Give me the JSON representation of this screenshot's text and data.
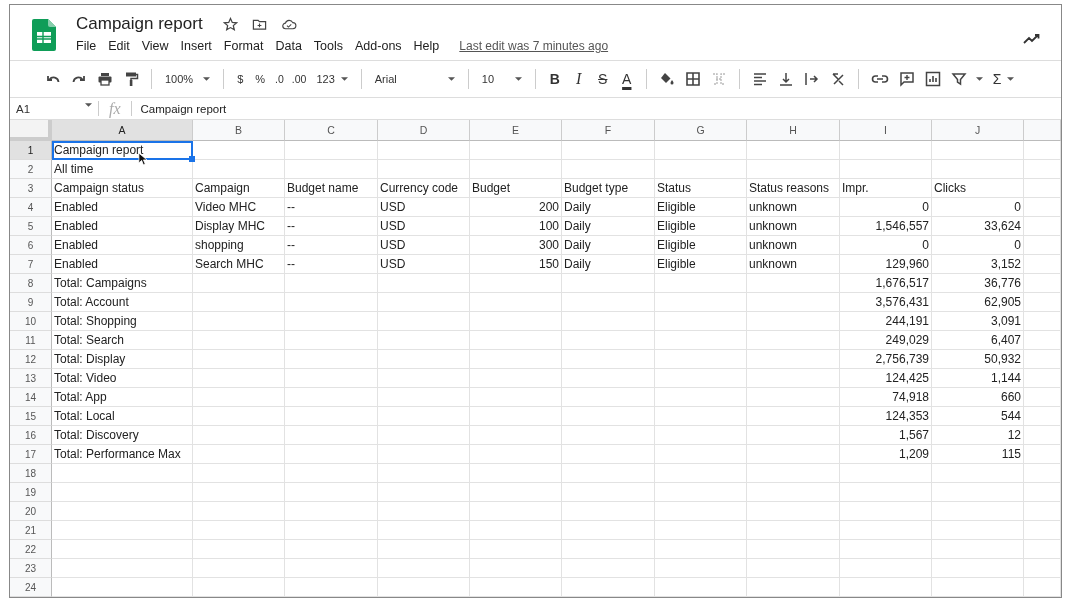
{
  "document": {
    "title": "Campaign report"
  },
  "menu": [
    "File",
    "Edit",
    "View",
    "Insert",
    "Format",
    "Data",
    "Tools",
    "Add-ons",
    "Help"
  ],
  "last_edit": "Last edit was 7 minutes ago",
  "toolbar": {
    "zoom": "100%",
    "currency": "$",
    "percent": "%",
    "decrease_decimals": ".0",
    "increase_decimals": ".00",
    "more_formats": "123",
    "font": "Arial",
    "font_size": "10",
    "bold": "B",
    "italic": "I",
    "strikethrough": "S",
    "text_color": "A",
    "functions": "Σ"
  },
  "formula_bar": {
    "cell_ref": "A1",
    "fx": "fx",
    "value": "Campaign report"
  },
  "columns": [
    {
      "letter": "A",
      "selected": true
    },
    {
      "letter": "B",
      "selected": false
    },
    {
      "letter": "C",
      "selected": false
    },
    {
      "letter": "D",
      "selected": false
    },
    {
      "letter": "E",
      "selected": false
    },
    {
      "letter": "F",
      "selected": false
    },
    {
      "letter": "G",
      "selected": false
    },
    {
      "letter": "H",
      "selected": false
    },
    {
      "letter": "I",
      "selected": false
    },
    {
      "letter": "J",
      "selected": false
    }
  ],
  "rows": [
    {
      "number": "1",
      "selected": true,
      "cells": {
        "A": "Campaign report"
      }
    },
    {
      "number": "2",
      "selected": false,
      "cells": {
        "A": "All time"
      }
    },
    {
      "number": "3",
      "selected": false,
      "cells": {
        "A": "Campaign status",
        "B": "Campaign",
        "C": "Budget name",
        "D": "Currency code",
        "E": "Budget",
        "F": "Budget type",
        "G": "Status",
        "H": "Status reasons",
        "I": "Impr.",
        "J": "Clicks"
      }
    },
    {
      "number": "4",
      "selected": false,
      "cells": {
        "A": "Enabled",
        "B": "Video MHC",
        "C": "--",
        "D": "USD",
        "E": "200",
        "F": "Daily",
        "G": "Eligible",
        "H": "unknown",
        "I": "0",
        "J": "0"
      }
    },
    {
      "number": "5",
      "selected": false,
      "cells": {
        "A": "Enabled",
        "B": "Display MHC",
        "C": "--",
        "D": "USD",
        "E": "100",
        "F": "Daily",
        "G": "Eligible",
        "H": "unknown",
        "I": "1,546,557",
        "J": "33,624"
      }
    },
    {
      "number": "6",
      "selected": false,
      "cells": {
        "A": "Enabled",
        "B": "shopping",
        "C": "--",
        "D": "USD",
        "E": "300",
        "F": "Daily",
        "G": "Eligible",
        "H": "unknown",
        "I": "0",
        "J": "0"
      }
    },
    {
      "number": "7",
      "selected": false,
      "cells": {
        "A": "Enabled",
        "B": "Search MHC",
        "C": "--",
        "D": "USD",
        "E": "150",
        "F": "Daily",
        "G": "Eligible",
        "H": "unknown",
        "I": "129,960",
        "J": "3,152"
      }
    },
    {
      "number": "8",
      "selected": false,
      "cells": {
        "A": "Total: Campaigns",
        "I": "1,676,517",
        "J": "36,776"
      }
    },
    {
      "number": "9",
      "selected": false,
      "cells": {
        "A": "Total: Account",
        "I": "3,576,431",
        "J": "62,905"
      }
    },
    {
      "number": "10",
      "selected": false,
      "cells": {
        "A": "Total: Shopping",
        "I": "244,191",
        "J": "3,091"
      }
    },
    {
      "number": "11",
      "selected": false,
      "cells": {
        "A": "Total: Search",
        "I": "249,029",
        "J": "6,407"
      }
    },
    {
      "number": "12",
      "selected": false,
      "cells": {
        "A": "Total: Display",
        "I": "2,756,739",
        "J": "50,932"
      }
    },
    {
      "number": "13",
      "selected": false,
      "cells": {
        "A": "Total: Video",
        "I": "124,425",
        "J": "1,144"
      }
    },
    {
      "number": "14",
      "selected": false,
      "cells": {
        "A": "Total: App",
        "I": "74,918",
        "J": "660"
      }
    },
    {
      "number": "15",
      "selected": false,
      "cells": {
        "A": "Total: Local",
        "I": "124,353",
        "J": "544"
      }
    },
    {
      "number": "16",
      "selected": false,
      "cells": {
        "A": "Total: Discovery",
        "I": "1,567",
        "J": "12"
      }
    },
    {
      "number": "17",
      "selected": false,
      "cells": {
        "A": "Total: Performance Max",
        "I": "1,209",
        "J": "115"
      }
    },
    {
      "number": "18",
      "selected": false,
      "cells": {}
    },
    {
      "number": "19",
      "selected": false,
      "cells": {}
    },
    {
      "number": "20",
      "selected": false,
      "cells": {}
    },
    {
      "number": "21",
      "selected": false,
      "cells": {}
    },
    {
      "number": "22",
      "selected": false,
      "cells": {}
    },
    {
      "number": "23",
      "selected": false,
      "cells": {}
    },
    {
      "number": "24",
      "selected": false,
      "cells": {}
    }
  ]
}
